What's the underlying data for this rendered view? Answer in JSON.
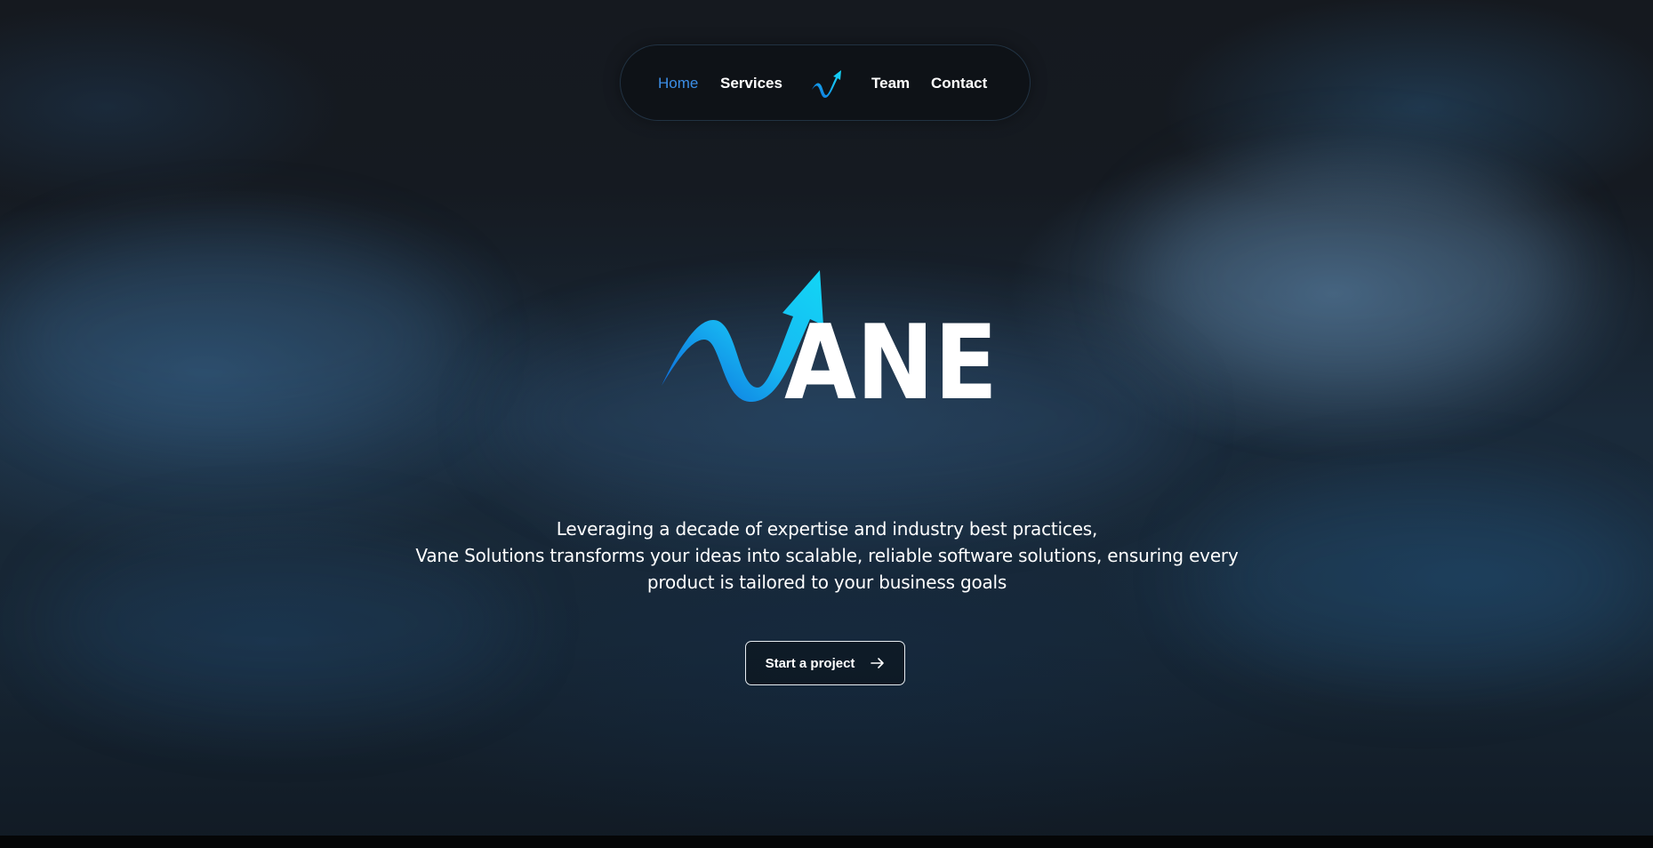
{
  "nav": {
    "items": [
      {
        "label": "Home",
        "active": true
      },
      {
        "label": "Services",
        "active": false
      },
      {
        "label": "Team",
        "active": false
      },
      {
        "label": "Contact",
        "active": false
      }
    ],
    "logo_icon": "vane-arrow-icon",
    "active_color": "#3c8ee6"
  },
  "brand": {
    "logo_text": "ANE",
    "logo_icon": "vane-arrow-logo",
    "gradient_colors": [
      "#0b62d9",
      "#17b8f2",
      "#12d6f5"
    ]
  },
  "hero": {
    "tagline_lines": [
      "Leveraging a decade of expertise and industry best practices,",
      "Vane Solutions transforms your ideas into scalable, reliable software solutions, ensuring every",
      "product is tailored to your business goals"
    ],
    "cta_label": "Start a project",
    "cta_icon": "arrow-right-icon"
  }
}
